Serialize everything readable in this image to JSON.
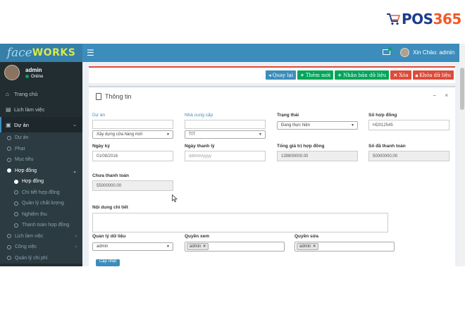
{
  "brand": {
    "left": "POS",
    "right": "365"
  },
  "app": {
    "logo": {
      "f": "face",
      "w": "WORKS"
    },
    "header": {
      "user_greeting": "Xin Chào: admin"
    }
  },
  "sidebar": {
    "user": {
      "name": "admin",
      "status": "Online"
    },
    "items": [
      {
        "label": "Trang chủ"
      },
      {
        "label": "Lịch làm việc"
      },
      {
        "label": "Dự án"
      }
    ],
    "sub": [
      {
        "label": "Dự án"
      },
      {
        "label": "Phạt"
      },
      {
        "label": "Mục tiêu"
      },
      {
        "label": "Hợp đồng"
      }
    ],
    "subsub": [
      {
        "label": "Hợp đồng"
      },
      {
        "label": "Chi tiết hợp đồng"
      },
      {
        "label": "Quản lý chất lượng"
      },
      {
        "label": "Nghiệm thu"
      },
      {
        "label": "Thanh toán hợp đồng"
      }
    ],
    "tail": [
      {
        "label": "Lịch làm việc"
      },
      {
        "label": "Công việc"
      },
      {
        "label": "Quản lý chi phí"
      }
    ]
  },
  "toolbar": {
    "back": "Quay lại",
    "add": "Thêm mới",
    "copy": "Nhân bản dữ liệu",
    "delete": "Xóa",
    "lock": "Khóa dữ liệu"
  },
  "form": {
    "title": "Thông tin",
    "tools": {
      "minimize": "−",
      "close": "×"
    },
    "fields": {
      "du_an": {
        "label": "Dự án",
        "value": "Xây dựng cửa hàng mới"
      },
      "nha_cung_cap": {
        "label": "Nhà cung cấp",
        "value": "TIT"
      },
      "trang_thai": {
        "label": "Trạng thái",
        "value": "Đang thực hiện"
      },
      "so_hop_dong": {
        "label": "Số hợp đồng",
        "value": "HD012545"
      },
      "ngay_ky": {
        "label": "Ngày ký",
        "value": "01/08/2016"
      },
      "ngay_thanh_ly": {
        "label": "Ngày thanh lý",
        "placeholder": "dd/mm/yyyy"
      },
      "tong_gia_tri": {
        "label": "Tổng giá trị hợp đồng",
        "value": "139800000.00"
      },
      "so_da_thanh_toan": {
        "label": "Số đã thanh toán",
        "value": "50000000.00"
      },
      "chua_thanh_toan": {
        "label": "Chưa thanh toán",
        "value": "55000000.00"
      },
      "noi_dung": {
        "label": "Nội dung chi tiết"
      },
      "quan_ly_du_lieu": {
        "label": "Quản lý dữ liệu",
        "value": "admin"
      },
      "quyen_xem": {
        "label": "Quyền xem",
        "tag": "admin"
      },
      "quyen_sua": {
        "label": "Quyền sửa",
        "tag": "admin"
      }
    },
    "save": "Cập nhật"
  }
}
